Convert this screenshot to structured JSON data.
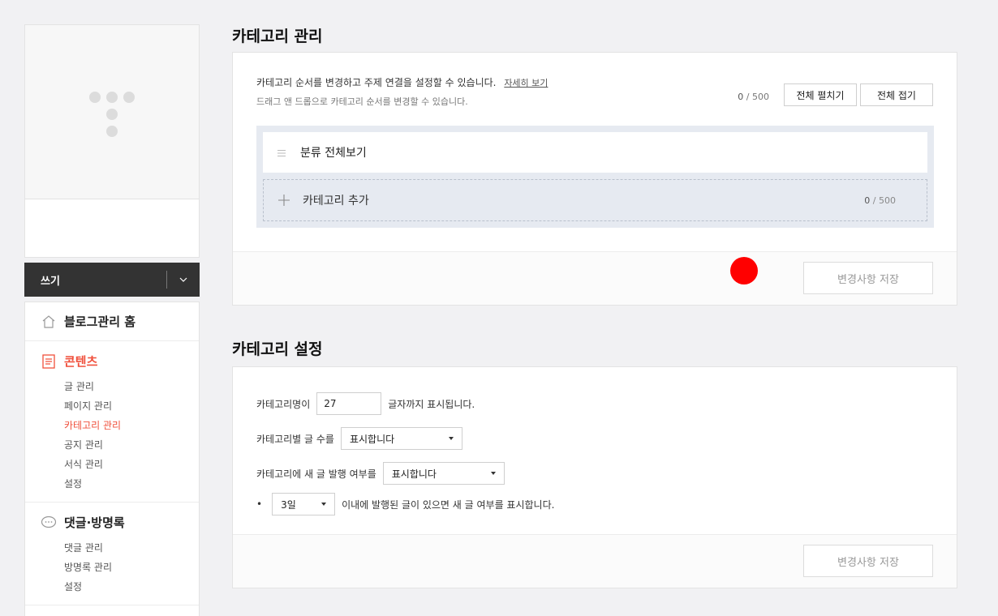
{
  "sidebar": {
    "write_label": "쓰기",
    "menu": {
      "home": "블로그관리 홈",
      "contents": {
        "title": "콘텐츠",
        "items": [
          "글 관리",
          "페이지 관리",
          "카테고리 관리",
          "공지 관리",
          "서식 관리",
          "설정"
        ]
      },
      "comments": {
        "title": "댓글·방명록",
        "items": [
          "댓글 관리",
          "방명록 관리",
          "설정"
        ]
      }
    }
  },
  "category_manage": {
    "title": "카테고리 관리",
    "desc": "카테고리 순서를 변경하고 주제 연결을 설정할 수 있습니다.",
    "detail_link": "자세히 보기",
    "drag_hint": "드래그 앤 드롭으로 카테고리 순서를 변경할 수 있습니다.",
    "count_current": "0",
    "count_max": "/ 500",
    "expand_all": "전체 펼치기",
    "collapse_all": "전체 접기",
    "root_category": "분류 전체보기",
    "add_category": "카테고리 추가",
    "add_count_current": "0",
    "add_count_max": "/ 500",
    "save_label": "변경사항 저장"
  },
  "category_settings": {
    "title": "카테고리 설정",
    "name_prefix": "카테고리명이",
    "name_value": "27",
    "name_suffix": "글자까지 표시됩니다.",
    "postcount_label": "카테고리별 글 수를",
    "postcount_value": "표시합니다",
    "newpost_label": "카테고리에 새 글 발행 여부를",
    "newpost_value": "표시합니다",
    "bullet": "•",
    "days_value": "3일",
    "days_suffix": "이내에 발행된 글이 있으면 새 글 여부를 표시합니다.",
    "save_label": "변경사항 저장"
  },
  "colors": {
    "accent": "#f0503c",
    "marker": "#ff0000"
  }
}
